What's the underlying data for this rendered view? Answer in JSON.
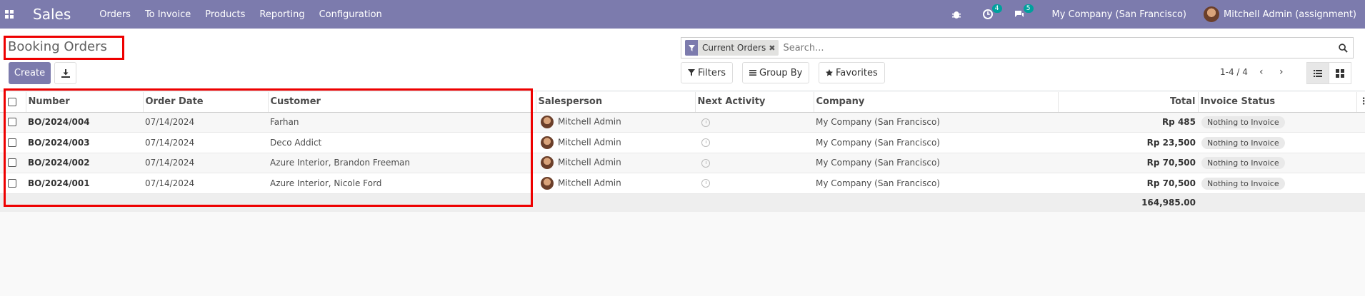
{
  "navbar": {
    "app_name": "Sales",
    "menu": [
      "Orders",
      "To Invoice",
      "Products",
      "Reporting",
      "Configuration"
    ],
    "activity_count": "4",
    "message_count": "5",
    "company": "My Company (San Francisco)",
    "user": "Mitchell Admin (assignment)"
  },
  "control_panel": {
    "title": "Booking Orders",
    "create_label": "Create",
    "search": {
      "facet": "Current Orders",
      "placeholder": "Search..."
    },
    "filters_label": "Filters",
    "groupby_label": "Group By",
    "favorites_label": "Favorites",
    "pager": "1-4 / 4"
  },
  "table": {
    "columns": [
      "Number",
      "Order Date",
      "Customer",
      "Salesperson",
      "Next Activity",
      "Company",
      "Total",
      "Invoice Status"
    ],
    "rows": [
      {
        "number": "BO/2024/004",
        "date": "07/14/2024",
        "customer": "Farhan",
        "salesperson": "Mitchell Admin",
        "company": "My Company (San Francisco)",
        "total": "Rp 485",
        "status": "Nothing to Invoice"
      },
      {
        "number": "BO/2024/003",
        "date": "07/14/2024",
        "customer": "Deco Addict",
        "salesperson": "Mitchell Admin",
        "company": "My Company (San Francisco)",
        "total": "Rp 23,500",
        "status": "Nothing to Invoice"
      },
      {
        "number": "BO/2024/002",
        "date": "07/14/2024",
        "customer": "Azure Interior, Brandon Freeman",
        "salesperson": "Mitchell Admin",
        "company": "My Company (San Francisco)",
        "total": "Rp 70,500",
        "status": "Nothing to Invoice"
      },
      {
        "number": "BO/2024/001",
        "date": "07/14/2024",
        "customer": "Azure Interior, Nicole Ford",
        "salesperson": "Mitchell Admin",
        "company": "My Company (San Francisco)",
        "total": "Rp 70,500",
        "status": "Nothing to Invoice"
      }
    ],
    "grand_total": "164,985.00"
  },
  "colors": {
    "brand": "#7c7bad",
    "highlight": "#e00000",
    "badge": "#00a09d"
  }
}
